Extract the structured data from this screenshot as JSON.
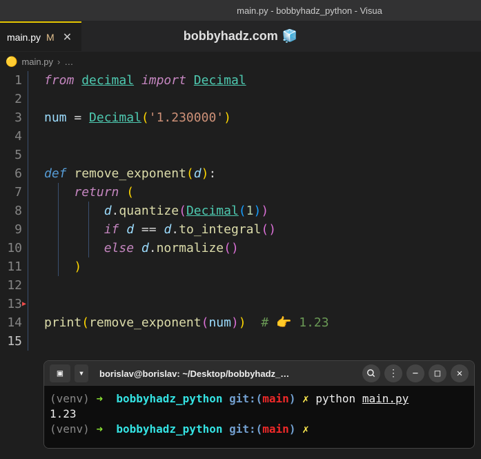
{
  "titlebar": "main.py - bobbyhadz_python - Visua",
  "tab": {
    "label": "main.py",
    "mod": "M"
  },
  "watermark": "bobbyhadz.com",
  "breadcrumb": {
    "file": "main.py",
    "sep": "›",
    "dots": "…"
  },
  "code": {
    "l1": {
      "from": "from",
      "decimal": "decimal",
      "import": "import",
      "Decimal": "Decimal"
    },
    "l3": {
      "num": "num",
      "eq": "=",
      "Decimal": "Decimal",
      "str": "'1.230000'"
    },
    "l6": {
      "def": "def",
      "fn": "remove_exponent",
      "param": "d"
    },
    "l7": {
      "ret": "return"
    },
    "l8": {
      "d": "d",
      "quantize": "quantize",
      "Decimal": "Decimal",
      "one": "1"
    },
    "l9": {
      "if": "if",
      "d": "d",
      "eqeq": "==",
      "d2": "d",
      "to_integral": "to_integral"
    },
    "l10": {
      "else": "else",
      "d": "d",
      "normalize": "normalize"
    },
    "l14": {
      "print": "print",
      "fn": "remove_exponent",
      "num": "num",
      "cmt": "# 👉️ 1.23"
    }
  },
  "terminal": {
    "title": "borislav@borislav: ~/Desktop/bobbyhadz_…",
    "lines": {
      "l1": {
        "venv": "(venv)",
        "arrow": "➜ ",
        "dir": "bobbyhadz_python",
        "git": "git:(",
        "branch": "main",
        "close": ")",
        "x": "✗",
        "cmd": "python ",
        "file": "main.py"
      },
      "l2": "1.23",
      "l3": {
        "venv": "(venv)",
        "arrow": "➜ ",
        "dir": "bobbyhadz_python",
        "git": "git:(",
        "branch": "main",
        "close": ")",
        "x": "✗"
      }
    }
  }
}
